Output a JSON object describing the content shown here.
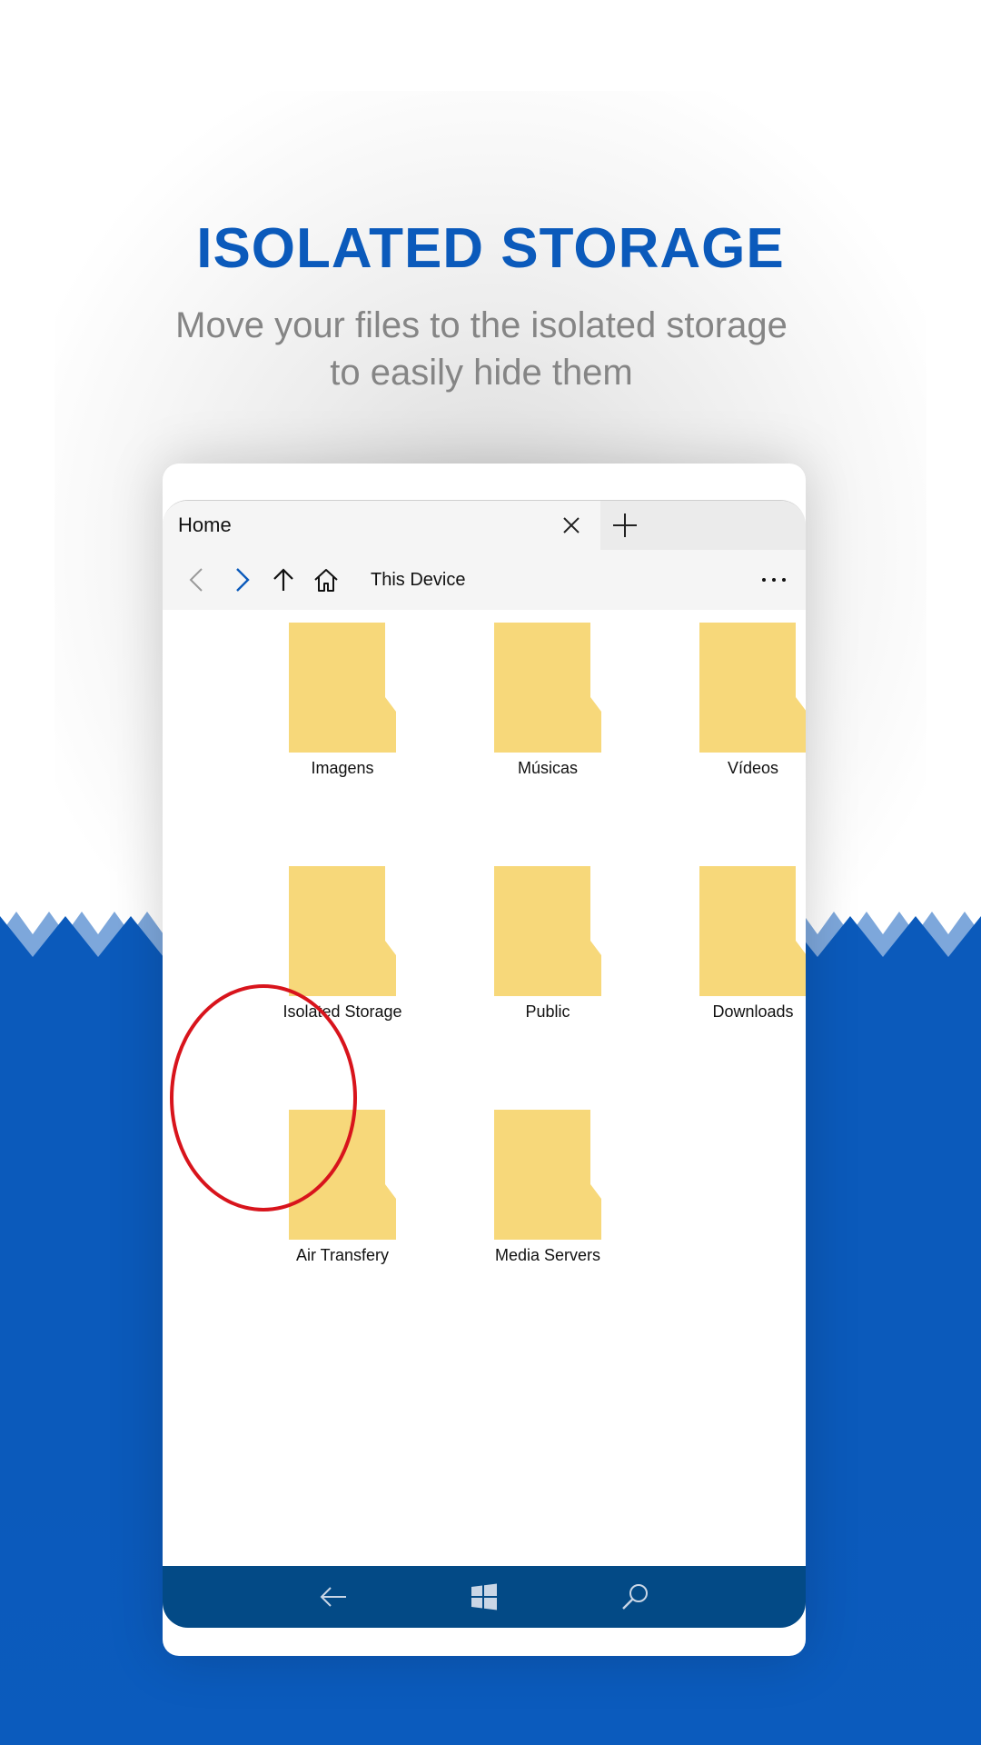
{
  "headline": "ISOLATED STORAGE",
  "subtitle_line1": "Move your files to the isolated storage",
  "subtitle_line2": "to easily hide them",
  "app": {
    "tab_title": "Home",
    "path": "This Device"
  },
  "folders": [
    {
      "label": "Imagens"
    },
    {
      "label": "Músicas"
    },
    {
      "label": "Vídeos"
    },
    {
      "label": "Isolated Storage"
    },
    {
      "label": "Public"
    },
    {
      "label": "Downloads"
    },
    {
      "label": "Air Transfery"
    },
    {
      "label": "Media Servers"
    }
  ],
  "colors": {
    "brand_blue": "#0b5abb",
    "folder_yellow": "#f7d87a",
    "highlight_red": "#d8141c",
    "taskbar_blue": "#034a86"
  },
  "icons": [
    "close-icon",
    "plus-icon",
    "back-arrow-icon",
    "forward-arrow-icon",
    "up-arrow-icon",
    "home-icon",
    "more-icon",
    "folder-icon",
    "windows-logo-icon",
    "search-icon"
  ]
}
